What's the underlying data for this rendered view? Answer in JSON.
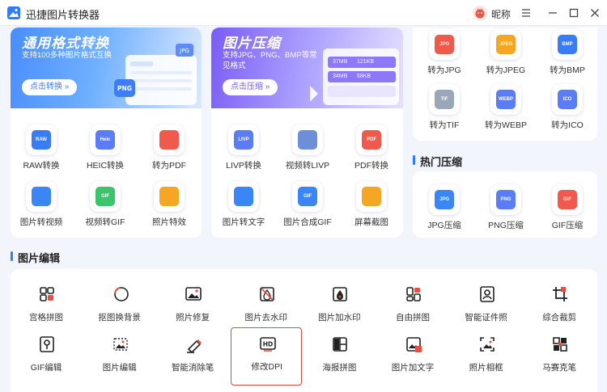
{
  "app": {
    "title": "迅捷图片转换器",
    "user_name": "昵称"
  },
  "colors": {
    "accent": "#2f7bff",
    "selected_border": "#e0473c",
    "banner_blue": "#4a8dfb",
    "banner_purple": "#7a5cf4"
  },
  "banners": [
    {
      "title": "通用格式转换",
      "subtitle": "支持100多种图片格式互换",
      "button": "点击转换 »"
    },
    {
      "title": "图片压缩",
      "subtitle": "支持JPG、PNG、BMP等常见格式",
      "button": "点击压缩 »",
      "stats": [
        "37MB",
        "121KB",
        "34MB",
        "68KB"
      ]
    }
  ],
  "convert_left": [
    {
      "label": "RAW转换",
      "icon": "raw-icon",
      "tag": "RAW"
    },
    {
      "label": "HEIC转换",
      "icon": "heic-icon",
      "tag": "Heic"
    },
    {
      "label": "转为PDF",
      "icon": "pdf-icon",
      "tag": ""
    },
    {
      "label": "图片转视频",
      "icon": "image-to-video-icon",
      "tag": ""
    },
    {
      "label": "视频转GIF",
      "icon": "video-to-gif-icon",
      "tag": "GIF"
    },
    {
      "label": "照片特效",
      "icon": "photo-effect-icon",
      "tag": ""
    }
  ],
  "convert_mid": [
    {
      "label": "LIVP转换",
      "icon": "livp-icon",
      "tag": "LIVP"
    },
    {
      "label": "视频转LIVP",
      "icon": "video-to-livp-icon",
      "tag": ""
    },
    {
      "label": "PDF转换",
      "icon": "pdf-convert-icon",
      "tag": "PDF"
    },
    {
      "label": "图片转文字",
      "icon": "image-to-text-icon",
      "tag": ""
    },
    {
      "label": "图片合成GIF",
      "icon": "gif-compose-icon",
      "tag": "GIF"
    },
    {
      "label": "屏幕截图",
      "icon": "screenshot-icon",
      "tag": ""
    }
  ],
  "convert_right": [
    {
      "label": "转为JPG",
      "icon": "jpg-icon",
      "tag": "JPG"
    },
    {
      "label": "转为JPEG",
      "icon": "jpeg-icon",
      "tag": "JPEG"
    },
    {
      "label": "转为BMP",
      "icon": "bmp-icon",
      "tag": "BMP"
    },
    {
      "label": "转为TIF",
      "icon": "tif-icon",
      "tag": "TIF"
    },
    {
      "label": "转为WEBP",
      "icon": "webp-icon",
      "tag": "WEBP"
    },
    {
      "label": "转为ICO",
      "icon": "ico-icon",
      "tag": "ICO"
    }
  ],
  "hot_compress": {
    "title": "热门压缩",
    "items": [
      {
        "label": "JPG压缩",
        "icon": "jpg-compress-icon",
        "tag": "JPG"
      },
      {
        "label": "PNG压缩",
        "icon": "png-compress-icon",
        "tag": "PNG"
      },
      {
        "label": "GIF压缩",
        "icon": "gif-compress-icon",
        "tag": "GIF"
      }
    ]
  },
  "image_edit": {
    "title": "图片编辑",
    "selected": "修改DPI",
    "items": [
      {
        "label": "宫格拼图",
        "icon": "grid-collage-icon"
      },
      {
        "label": "抠图换背景",
        "icon": "cutout-icon"
      },
      {
        "label": "照片修复",
        "icon": "photo-repair-icon"
      },
      {
        "label": "图片去水印",
        "icon": "remove-watermark-icon"
      },
      {
        "label": "图片加水印",
        "icon": "add-watermark-icon"
      },
      {
        "label": "自由拼图",
        "icon": "free-collage-icon"
      },
      {
        "label": "智能证件照",
        "icon": "id-photo-icon"
      },
      {
        "label": "综合裁剪",
        "icon": "crop-icon"
      },
      {
        "label": "GIF编辑",
        "icon": "gif-edit-icon"
      },
      {
        "label": "图片编辑",
        "icon": "image-edit-icon"
      },
      {
        "label": "智能消除笔",
        "icon": "eraser-pen-icon"
      },
      {
        "label": "修改DPI",
        "icon": "dpi-icon"
      },
      {
        "label": "海报拼图",
        "icon": "poster-collage-icon"
      },
      {
        "label": "图片加文字",
        "icon": "add-text-icon"
      },
      {
        "label": "照片相框",
        "icon": "photo-frame-icon"
      },
      {
        "label": "马赛克笔",
        "icon": "mosaic-pen-icon"
      }
    ]
  }
}
